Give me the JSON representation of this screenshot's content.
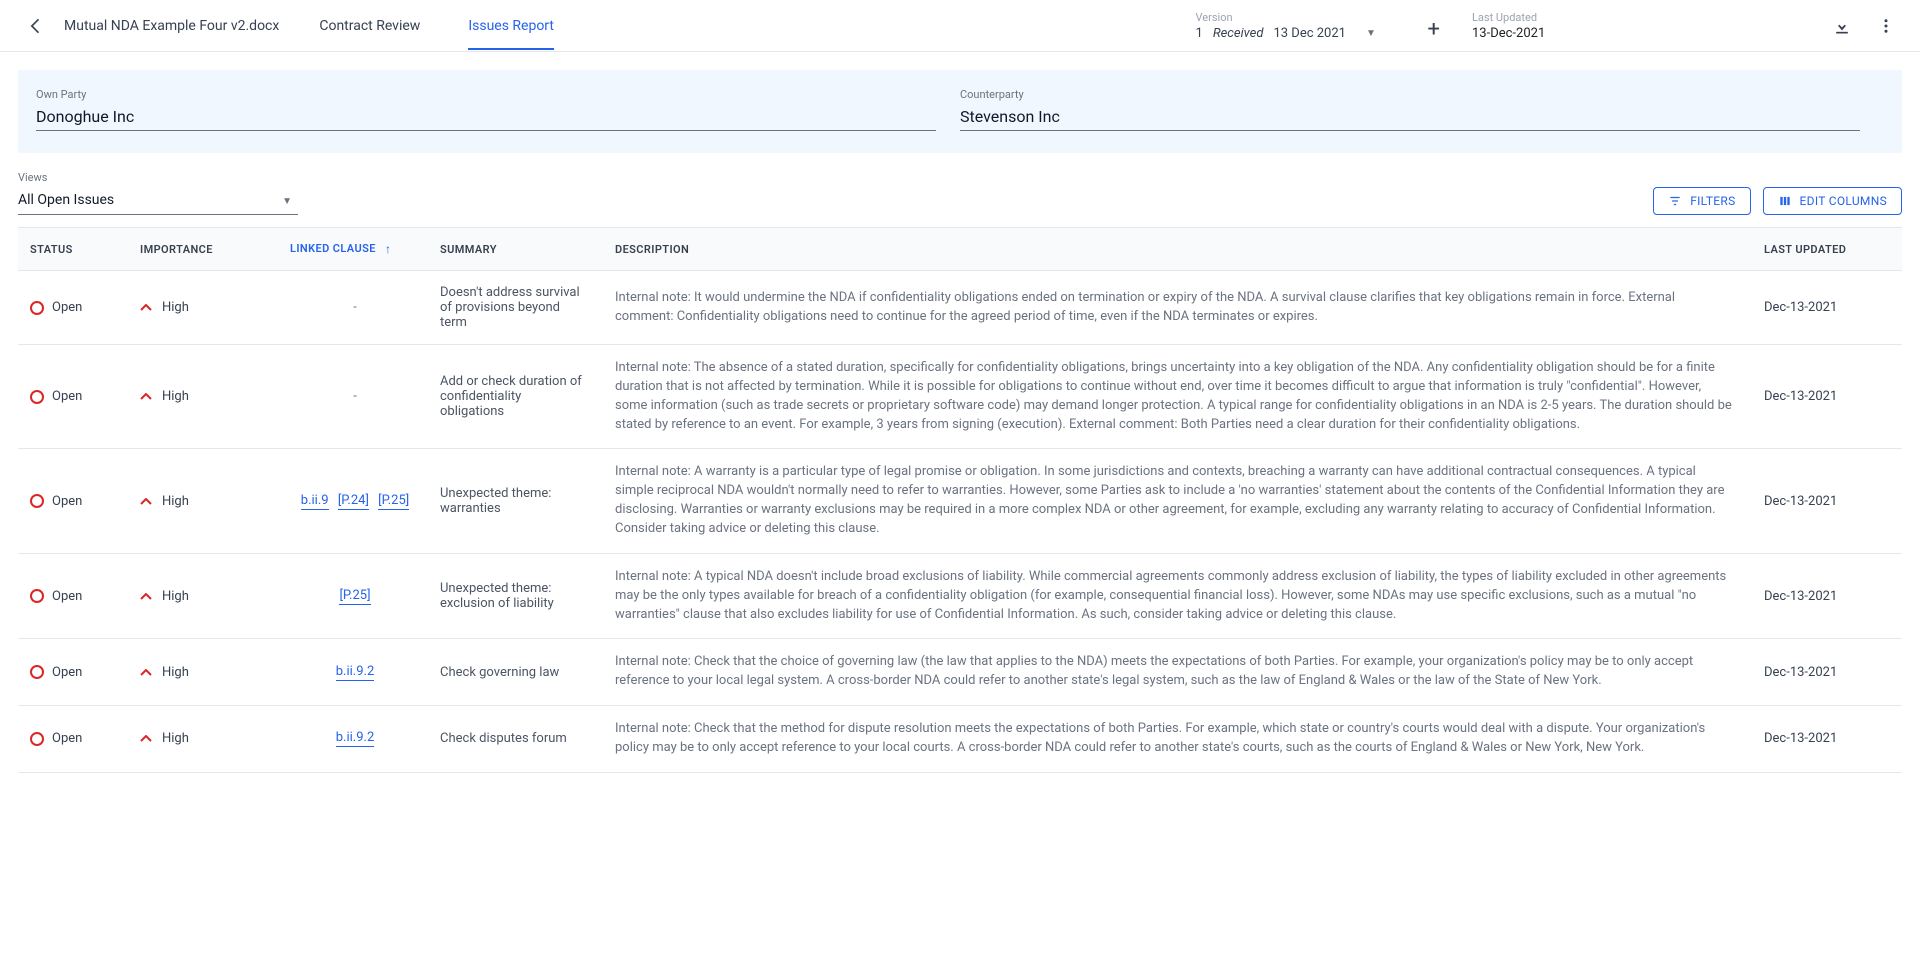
{
  "header": {
    "doc_title": "Mutual NDA Example Four v2.docx",
    "tabs": [
      {
        "label": "Contract Review",
        "active": false
      },
      {
        "label": "Issues Report",
        "active": true
      }
    ],
    "version": {
      "label": "Version",
      "number": "1",
      "status": "Received",
      "date": "13 Dec 2021"
    },
    "last_updated": {
      "label": "Last Updated",
      "value": "13-Dec-2021"
    }
  },
  "parties": {
    "own": {
      "label": "Own Party",
      "value": "Donoghue Inc"
    },
    "counter": {
      "label": "Counterparty",
      "value": "Stevenson Inc"
    }
  },
  "views": {
    "label": "Views",
    "selected": "All Open Issues"
  },
  "actions": {
    "filters": "FILTERS",
    "edit_columns": "EDIT COLUMNS"
  },
  "columns": {
    "status": "STATUS",
    "importance": "IMPORTANCE",
    "linked_clause": "LINKED CLAUSE",
    "summary": "SUMMARY",
    "description": "DESCRIPTION",
    "last_updated": "LAST UPDATED"
  },
  "rows": [
    {
      "status": "Open",
      "importance": "High",
      "linked": [],
      "summary": "Doesn't address survival of provisions beyond term",
      "description": "Internal note: It would undermine the NDA if confidentiality obligations ended on termination or expiry of the NDA. A survival clause clarifies that key obligations remain in force. External comment: Confidentiality obligations need to continue for the agreed period of time, even if the NDA terminates or expires.",
      "updated": "Dec-13-2021"
    },
    {
      "status": "Open",
      "importance": "High",
      "linked": [],
      "summary": "Add or check duration of confidentiality obligations",
      "description": "Internal note: The absence of a stated duration, specifically for confidentiality obligations, brings uncertainty into a key obligation of the NDA. Any confidentiality obligation should be for a finite duration that is not affected by termination. While it is possible for obligations to continue without end, over time it becomes difficult to argue that information is truly \"confidential\". However, some information (such as trade secrets or proprietary software code) may demand longer protection. A typical range for confidentiality obligations in an NDA is 2-5 years. The duration should be stated by reference to an event. For example, 3 years from signing (execution). External comment: Both Parties need a clear duration for their confidentiality obligations.",
      "updated": "Dec-13-2021"
    },
    {
      "status": "Open",
      "importance": "High",
      "linked": [
        "b.ii.9",
        "[P.24]",
        "[P.25]"
      ],
      "summary": "Unexpected theme: warranties",
      "description": "Internal note: A warranty is a particular type of legal promise or obligation. In some jurisdictions and contexts, breaching a warranty can have additional contractual consequences. A typical simple reciprocal NDA wouldn't normally need to refer to warranties. However, some Parties ask to include a 'no warranties' statement about the contents of the Confidential Information they are disclosing. Warranties or warranty exclusions may be required in a more complex NDA or other agreement, for example, excluding any warranty relating to accuracy of Confidential Information. Consider taking advice or deleting this clause.",
      "updated": "Dec-13-2021"
    },
    {
      "status": "Open",
      "importance": "High",
      "linked": [
        "[P.25]"
      ],
      "summary": "Unexpected theme: exclusion of liability",
      "description": "Internal note: A typical NDA doesn't include broad exclusions of liability. While commercial agreements commonly address exclusion of liability, the types of liability excluded in other agreements may be the only types available for breach of a confidentiality obligation (for example, consequential financial loss). However, some NDAs may use specific exclusions, such as a mutual \"no warranties\" clause that also excludes liability for use of Confidential Information. As such, consider taking advice or deleting this clause.",
      "updated": "Dec-13-2021"
    },
    {
      "status": "Open",
      "importance": "High",
      "linked": [
        "b.ii.9.2"
      ],
      "summary": "Check governing law",
      "description": "Internal note: Check that the choice of governing law (the law that applies to the NDA) meets the expectations of both Parties. For example, your organization's policy may be to only accept reference to your local legal system. A cross-border NDA could refer to another state's legal system, such as the law of England & Wales or the law of the State of New York.",
      "updated": "Dec-13-2021"
    },
    {
      "status": "Open",
      "importance": "High",
      "linked": [
        "b.ii.9.2"
      ],
      "summary": "Check disputes forum",
      "description": "Internal note: Check that the method for dispute resolution meets the expectations of both Parties. For example, which state or country's courts would deal with a dispute. Your organization's policy may be to only accept reference to your local courts. A cross-border NDA could refer to another state's courts, such as the courts of England & Wales or New York, New York.",
      "updated": "Dec-13-2021"
    }
  ]
}
